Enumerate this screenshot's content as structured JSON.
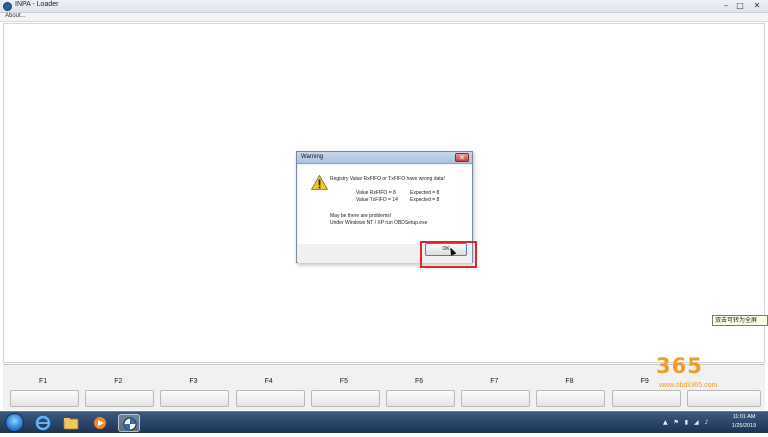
{
  "window": {
    "title": "INPA - Loader",
    "menu_about": "About...",
    "controls": {
      "minimize": "–",
      "maximize": "□",
      "close": "✕"
    }
  },
  "dialog": {
    "title": "Warning",
    "close_glyph": "✕",
    "icon": "warning-triangle-icon",
    "line_heading": "Registry Value RxFIFO or TxFIFO have wrong data!",
    "rx_value": "Value RxFIFO = 8",
    "rx_expected": "Expected = 8",
    "tx_value": "Value TxFIFO = 14",
    "tx_expected": "Expected = 8",
    "line_problems": "May be there are problems!",
    "line_setup": "Under Windows NT / XP run OBDSetup.exe",
    "ok_label": "OK"
  },
  "function_keys": [
    "F1",
    "F2",
    "F3",
    "F4",
    "F5",
    "F6",
    "F7",
    "F8",
    "F9"
  ],
  "ime_tooltip": "双击可转为全屏",
  "watermark": {
    "number": "365",
    "url": "www.obdii365.com"
  },
  "taskbar": {
    "items": [
      "start-orb",
      "internet-explorer-icon",
      "file-explorer-icon",
      "media-player-icon",
      "inpa-app-icon"
    ],
    "tray_glyphs": "▲ ⚑ ▮ ◢ ♪",
    "time": "11:01 AM",
    "date": "1/25/2019"
  },
  "colors": {
    "highlight": "#e0262b",
    "taskbar": "#1d3352",
    "dialog_title": "#a9c0de",
    "watermark": "#f29b25"
  }
}
